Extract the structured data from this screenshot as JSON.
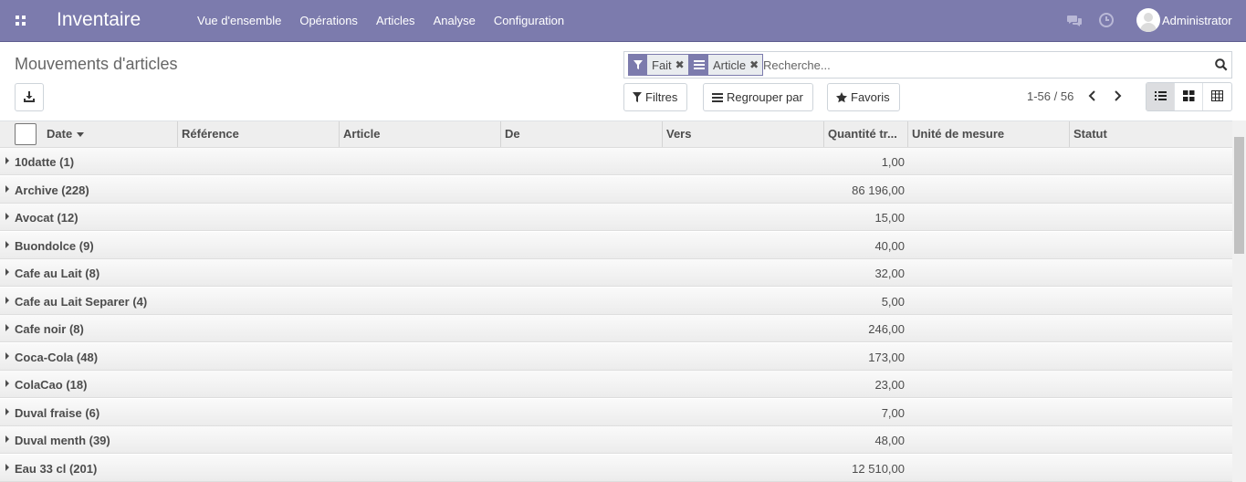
{
  "navbar": {
    "app_title": "Inventaire",
    "menu": [
      "Vue d'ensemble",
      "Opérations",
      "Articles",
      "Analyse",
      "Configuration"
    ],
    "user": "Administrator",
    "icons": [
      "apps-icon",
      "chat-icon",
      "clock-icon",
      "avatar"
    ],
    "color": "#7c7bad"
  },
  "control_panel": {
    "title": "Mouvements d'articles",
    "facets": [
      {
        "label": "Fait",
        "icon": "filter-icon"
      },
      {
        "label": "Article",
        "icon": "group-by-icon"
      }
    ],
    "search_placeholder": "Recherche...",
    "filters_label": "Filtres",
    "group_by_label": "Regrouper par",
    "favorites_label": "Favoris",
    "pager": "1-56 / 56",
    "active_view": "list"
  },
  "table": {
    "columns": [
      "Date",
      "Référence",
      "Article",
      "De",
      "Vers",
      "Quantité tr...",
      "Unité de mesure",
      "Statut"
    ],
    "sorted_column": "Date",
    "groups": [
      {
        "name": "10datte (1)",
        "qty": "1,00"
      },
      {
        "name": "Archive (228)",
        "qty": "86 196,00"
      },
      {
        "name": "Avocat (12)",
        "qty": "15,00"
      },
      {
        "name": "Buondolce (9)",
        "qty": "40,00"
      },
      {
        "name": "Cafe au Lait (8)",
        "qty": "32,00"
      },
      {
        "name": "Cafe au Lait Separer (4)",
        "qty": "5,00"
      },
      {
        "name": "Cafe noir (8)",
        "qty": "246,00"
      },
      {
        "name": "Coca-Cola (48)",
        "qty": "173,00"
      },
      {
        "name": "ColaCao (18)",
        "qty": "23,00"
      },
      {
        "name": "Duval fraise (6)",
        "qty": "7,00"
      },
      {
        "name": "Duval menth (39)",
        "qty": "48,00"
      },
      {
        "name": "Eau 33 cl (201)",
        "qty": "12 510,00"
      }
    ]
  }
}
